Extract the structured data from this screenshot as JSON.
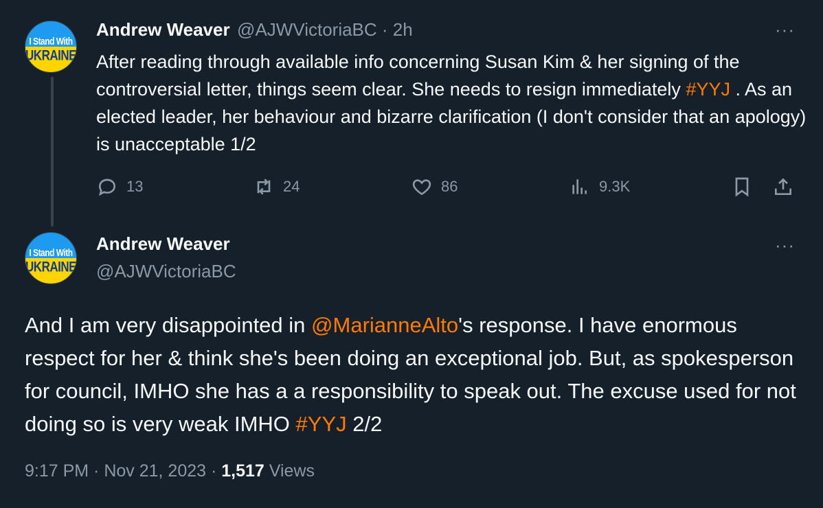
{
  "tweet1": {
    "avatar": {
      "line1": "I Stand With",
      "line2": "UKRAINE"
    },
    "name": "Andrew Weaver",
    "handle": "@AJWVictoriaBC",
    "separator": " · ",
    "time": "2h",
    "more": "···",
    "text_before_tag": "After reading through available info concerning Susan Kim & her signing of the controversial letter, things seem clear. She needs to resign immediately ",
    "hashtag": "#YYJ",
    "text_after_tag": " . As an elected leader, her behaviour and bizarre clarification (I don't consider that an apology) is unacceptable  1/2",
    "replies": "13",
    "retweets": "24",
    "likes": "86",
    "views": "9.3K"
  },
  "tweet2": {
    "avatar": {
      "line1": "I Stand With",
      "line2": "UKRAINE"
    },
    "name": "Andrew Weaver",
    "handle": "@AJWVictoriaBC",
    "more": "···",
    "text_part1": "And I am very disappointed in ",
    "mention": "@MarianneAlto",
    "text_part2": "'s response. I have enormous respect for her & think she's been doing an exceptional job. But, as spokesperson for council, IMHO she has a a responsibility to speak out. The excuse used for not doing so is very weak IMHO ",
    "hashtag": "#YYJ",
    "text_part3": " 2/2",
    "timestamp": "9:17 PM · Nov 21, 2023 · ",
    "views_count": "1,517",
    "views_label": " Views"
  },
  "colors": {
    "background": "#15202b",
    "accent": "#ff7a00",
    "muted": "#8b98a5",
    "text": "#f7f9f9"
  },
  "icons": [
    "reply-icon",
    "retweet-icon",
    "like-icon",
    "views-icon",
    "bookmark-icon",
    "share-icon"
  ]
}
